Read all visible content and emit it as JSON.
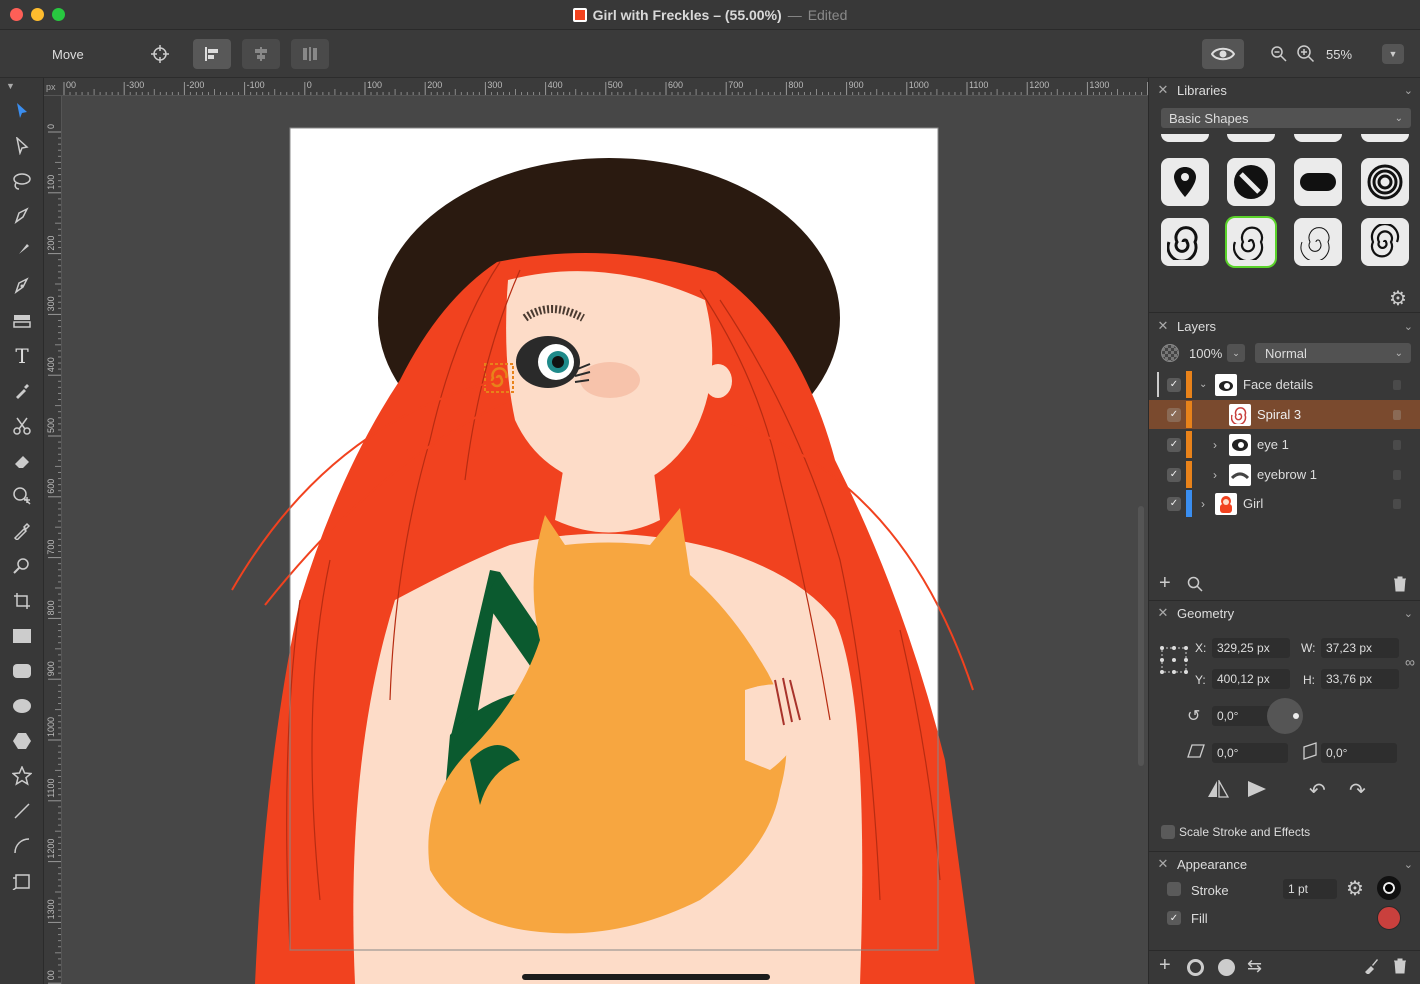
{
  "window": {
    "title": "Girl with Freckles – (55.00%)",
    "separator": "—",
    "status": "Edited"
  },
  "toolbar": {
    "mode_label": "Move",
    "zoom_value": "55%"
  },
  "ruler": {
    "unit": "px",
    "top_ticks": [
      "00",
      "-300",
      "-200",
      "-100",
      "0",
      "100",
      "200",
      "300",
      "400",
      "500",
      "600",
      "700",
      "800",
      "900",
      "1000",
      "1100",
      "1200",
      "1300",
      "140"
    ],
    "left_ticks": [
      "0",
      "100",
      "200",
      "300",
      "400",
      "500",
      "600",
      "700",
      "800",
      "900",
      "1000",
      "1100",
      "1200",
      "1300",
      "00"
    ]
  },
  "libraries": {
    "title": "Libraries",
    "category": "Basic Shapes"
  },
  "layers": {
    "title": "Layers",
    "opacity": "100%",
    "blend_mode": "Normal",
    "items": [
      {
        "name": "Face details",
        "color": "#e8821a"
      },
      {
        "name": "Spiral 3",
        "color": "#e8821a"
      },
      {
        "name": "eye 1",
        "color": "#e8821a"
      },
      {
        "name": "eyebrow 1",
        "color": "#e8821a"
      },
      {
        "name": "Girl",
        "color": "#3a8ef0"
      }
    ]
  },
  "geometry": {
    "title": "Geometry",
    "x_label": "X:",
    "x": "329,25 px",
    "y_label": "Y:",
    "y": "400,12 px",
    "w_label": "W:",
    "w": "37,23 px",
    "h_label": "H:",
    "h": "33,76 px",
    "rotation": "0,0°",
    "skew_h": "0,0°",
    "skew_v": "0,0°",
    "scale_stroke_label": "Scale Stroke and Effects"
  },
  "appearance": {
    "title": "Appearance",
    "stroke_label": "Stroke",
    "stroke_width": "1 pt",
    "stroke_color": "#000000",
    "fill_label": "Fill",
    "fill_color": "#c9403d"
  },
  "colors": {
    "hair": "#f1421f",
    "hat": "#2a1a10",
    "cat": "#f7a640",
    "skin": "#fddcc8",
    "dress": "#0b5a2f",
    "selected_layer": "#7a4a2e",
    "library_highlight": "#5ad22a"
  }
}
